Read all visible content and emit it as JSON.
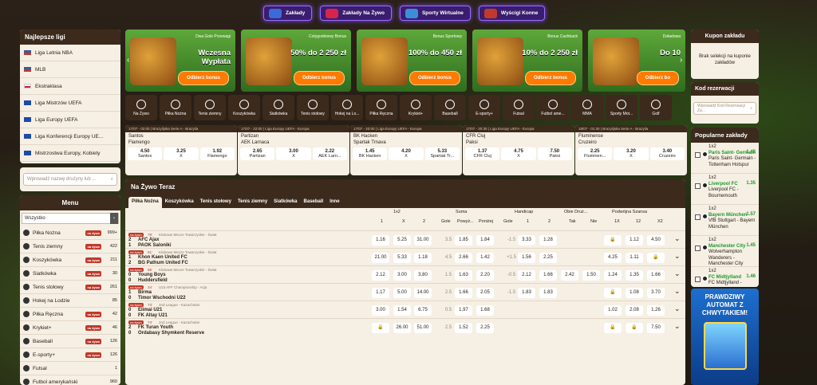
{
  "top_nav": [
    {
      "label": "Zakłady",
      "color": "#3b6bd8"
    },
    {
      "label": "Zakłady Na Żywo",
      "color": "#d8244a"
    },
    {
      "label": "Sporty Wirtualne",
      "color": "#3a8fd8"
    },
    {
      "label": "Wyścigi Konne",
      "color": "#c0392b"
    }
  ],
  "leagues": {
    "title": "Najlepsze ligi",
    "items": [
      {
        "label": "Liga Letnia NBA",
        "flag": "us"
      },
      {
        "label": "MLB",
        "flag": "us"
      },
      {
        "label": "Ekstraklasa",
        "flag": "pl"
      },
      {
        "label": "Liga Mistrzów UEFA",
        "flag": "eu"
      },
      {
        "label": "Liga Europy UEFA",
        "flag": "eu"
      },
      {
        "label": "Liga Konferencji Europy UE...",
        "flag": "eu"
      },
      {
        "label": "Mistrzostwa Europy, Kobiety",
        "flag": "eu"
      }
    ]
  },
  "team_search": {
    "placeholder": "Wprowadź nazwę drużyny lub ..."
  },
  "menu": {
    "title": "Menu",
    "filter": "Wszystko",
    "badge": "na żywo",
    "items": [
      {
        "label": "Piłka Nożna",
        "count": "999+"
      },
      {
        "label": "Tenis ziemny",
        "count": "422"
      },
      {
        "label": "Koszykówka",
        "count": "211"
      },
      {
        "label": "Siatkówka",
        "count": "30"
      },
      {
        "label": "Tenis stołowy",
        "count": "261"
      },
      {
        "label": "Hokej na Lodzie",
        "count": "85"
      },
      {
        "label": "Piłka Ręczna",
        "count": "42"
      },
      {
        "label": "Krykiet+",
        "count": "46"
      },
      {
        "label": "Baseball",
        "count": "126"
      },
      {
        "label": "E-sporty+",
        "count": "126"
      },
      {
        "label": "Futsal",
        "count": "1"
      },
      {
        "label": "Futbol amerykański",
        "count": "960"
      }
    ]
  },
  "banners": [
    {
      "top": "Dwa Gole Przewagi",
      "head": "Wczesna\nWypłata",
      "button": "Odbierz bonus"
    },
    {
      "top": "Cotygodniowy Bonus",
      "head": "50% do 2 250 zł",
      "button": "Odbierz bonus"
    },
    {
      "top": "Bonus Sportowy",
      "head": "100% do 450 zł",
      "button": "Odbierz bonus"
    },
    {
      "top": "Bonus Cashback",
      "head": "10% do 2 250 zł",
      "button": "Odbierz bonus"
    },
    {
      "top": "Doładowa",
      "head": "Do 10",
      "button": "Odbierz bo"
    }
  ],
  "sports": [
    "Na Żywo",
    "Piłka Nożna",
    "Tenis ziemny",
    "Koszykówka",
    "Siatkówka",
    "Tenis stołowy",
    "Hokej na Lo...",
    "Piłka Ręczna",
    "Krykiet+",
    "Baseball",
    "E-sporty+",
    "Futsal",
    "Futbol ame...",
    "MMA",
    "Sporty Mot...",
    "Golf"
  ],
  "cards": [
    {
      "head": "17/07 - 02:00 | Brazylijska Serie A - Brazylia",
      "t1": "Santos",
      "t2": "Flamengo",
      "odds": [
        [
          "4.50",
          "Santos"
        ],
        [
          "3.25",
          "X"
        ],
        [
          "1.92",
          "Flamengo"
        ]
      ]
    },
    {
      "head": "17/07 - 22:00 | Liga Europy UEFA - Europa",
      "t1": "Partizan",
      "t2": "AEK Larnaca",
      "odds": [
        [
          "2.65",
          "Partizan"
        ],
        [
          "3.00",
          "X"
        ],
        [
          "2.22",
          "AEK Larn..."
        ]
      ]
    },
    {
      "head": "17/07 - 20:00 | Liga Europy UEFA - Europa",
      "t1": "BK Hacken",
      "t2": "Spartak Trnava",
      "odds": [
        [
          "1.45",
          "BK Hacken"
        ],
        [
          "4.20",
          "X"
        ],
        [
          "5.33",
          "Spartak Tr..."
        ]
      ]
    },
    {
      "head": "17/07 - 20:30 | Liga Europy UEFA - Europa",
      "t1": "CFR Cluj",
      "t2": "Paksi",
      "odds": [
        [
          "1.37",
          "CFR Cluj"
        ],
        [
          "4.75",
          "X"
        ],
        [
          "7.50",
          "Paksi"
        ]
      ]
    },
    {
      "head": "18/07 - 01:30 | Brazylijska Serie A - Brazylia",
      "t1": "Fluminense",
      "t2": "Cruzeiro",
      "odds": [
        [
          "2.25",
          "Fluminen..."
        ],
        [
          "3.20",
          "X"
        ],
        [
          "3.40",
          "Cruzeiro"
        ]
      ]
    }
  ],
  "live": {
    "title": "Na Żywo Teraz",
    "tabs": [
      "Piłka Nożna",
      "Koszykówka",
      "Tenis stołowy",
      "Tenis ziemny",
      "Siatkówka",
      "Baseball",
      "Inne"
    ],
    "groups": {
      "g1": "1x2",
      "g2": "Suma",
      "g3": "Handicap",
      "g4": "Obie Druż...",
      "g5": "Podwójna Szansa"
    },
    "cols": {
      "c1": "1",
      "cx": "X",
      "c2": "2",
      "gole": "Gole",
      "pow": "Powyż...",
      "pon": "Poniżej",
      "hg": "Gole",
      "h1": "1",
      "h2": "2",
      "tak": "Tak",
      "nie": "Nie",
      "d1x": "1X",
      "d12": "12",
      "dx2": "X2"
    },
    "badge": "na żywo",
    "rows": [
      {
        "min": "79'",
        "cat": "Klubowe Mecze Towarzyskie - Świat",
        "s1": "2",
        "t1": "AFC Ajax",
        "s2": "1",
        "t2": "PAOK Saloniki",
        "o": [
          "1.16",
          "5.25",
          "31.00",
          "3.5",
          "1.85",
          "1.84",
          "-1.5",
          "3.33",
          "1.28",
          "",
          "",
          "🔒",
          "1.12",
          "4.50"
        ]
      },
      {
        "min": "61'",
        "cat": "Klubowe Mecze Towarzyskie - Świat",
        "s1": "1",
        "t1": "Khon Kaen United FC",
        "s2": "2",
        "t2": "BG Pathum United FC",
        "o": [
          "21.00",
          "5.33",
          "1.18",
          "4.5",
          "2.66",
          "1.42",
          "+1.5",
          "1.56",
          "2.25",
          "",
          "",
          "4.25",
          "1.11",
          "🔒"
        ]
      },
      {
        "min": "55'",
        "cat": "Klubowe Mecze Towarzyskie - Świat",
        "s1": "0",
        "t1": "Young Boys",
        "s2": "0",
        "t2": "Huddersfield",
        "o": [
          "2.12",
          "3.00",
          "3.80",
          "1.5",
          "1.63",
          "2.20",
          "-0.5",
          "2.12",
          "1.66",
          "2.42",
          "1.50",
          "1.24",
          "1.35",
          "1.66"
        ]
      },
      {
        "min": "34'",
        "cat": "U23 AFF Championship - Azja",
        "s1": "1",
        "t1": "Birma",
        "s2": "0",
        "t2": "Timor Wschodni U22",
        "o": [
          "1.17",
          "5.00",
          "14.00",
          "2.5",
          "1.66",
          "2.05",
          "-1.5",
          "1.83",
          "1.83",
          "",
          "",
          "🔒",
          "1.08",
          "3.70"
        ]
      },
      {
        "min": "73'",
        "cat": "2nd League - Kazachstan",
        "s1": "0",
        "t1": "Elimai U21",
        "s2": "0",
        "t2": "FK Altay U21",
        "o": [
          "3.00",
          "1.54",
          "6.75",
          "0.5",
          "1.97",
          "1.68",
          "",
          "",
          "",
          "",
          "",
          "1.02",
          "2.08",
          "1.26"
        ]
      },
      {
        "min": "74'",
        "cat": "2nd League - Kazachstan",
        "s1": "2",
        "t1": "FK Turan Youth",
        "s2": "0",
        "t2": "Ordabasy Shymkent Reserve",
        "o": [
          "🔒",
          "26.00",
          "51.00",
          "2.5",
          "1.52",
          "2.25",
          "",
          "",
          "",
          "",
          "",
          "🔒",
          "🔒",
          "7.50"
        ]
      }
    ]
  },
  "coupon": {
    "title": "Kupon zakładu",
    "empty": "Brak selekcji na kuponie zakładów"
  },
  "reservation": {
    "title": "Kod rezerwacji",
    "placeholder": "Wprowadź Kod Rezerwacji Za..."
  },
  "popular": {
    "title": "Popularne zakłady",
    "items": [
      {
        "type": "1x2",
        "pick": "Paris Saint- Germain",
        "match": "Paris Saint- Germain - Tottenham Hotspur",
        "odd": "1.48"
      },
      {
        "type": "1x2",
        "pick": "Liverpool FC",
        "match": "Liverpool FC - Bournemouth",
        "odd": "1.35"
      },
      {
        "type": "1x2",
        "pick": "Bayern München",
        "match": "VfB Stuttgart - Bayern München",
        "odd": "1.57"
      },
      {
        "type": "1x2",
        "pick": "Manchester City",
        "match": "Wolverhampton Wanderers - Manchester City",
        "odd": "1.45"
      },
      {
        "type": "1x2",
        "pick": "FC Midtjylland",
        "match": "FC Midtjylland - Hibernian FC",
        "odd": "1.46"
      }
    ]
  },
  "ad": {
    "text": "PRAWDZIWY AUTOMAT Z CHWYTAKIEM!"
  }
}
